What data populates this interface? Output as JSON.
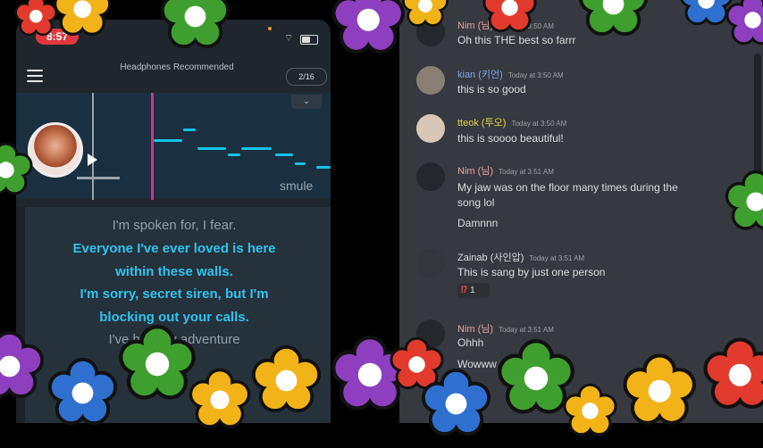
{
  "phone": {
    "time": "8:57",
    "header": "Headphones Recommended",
    "pager": "2/16",
    "logo": "smule",
    "lyrics": [
      {
        "text": "I'm spoken for, I fear.",
        "state": "dim"
      },
      {
        "text": "Everyone I've ever loved is here",
        "state": "active"
      },
      {
        "text": "within these walls.",
        "state": "active"
      },
      {
        "text": "I'm sorry, secret siren, but I'm",
        "state": "active"
      },
      {
        "text": "blocking out your calls.",
        "state": "active"
      },
      {
        "text": "I've had my adventure",
        "state": "dim"
      }
    ],
    "icons": {
      "menu": "hamburger-icon",
      "collapse": "chevron-down-icon",
      "play": "play-icon",
      "wifi": "wifi-icon",
      "battery": "battery-icon",
      "mic": "mic-icon"
    }
  },
  "chat": {
    "messages": [
      {
        "author": "Nim (님)",
        "color": "#e8a6a6",
        "time": "Today at 3:50 AM",
        "lines": [
          "Oh this THE best so farrr"
        ]
      },
      {
        "author": "kian (키언)",
        "color": "#7ea6f0",
        "time": "Today at 3:50 AM",
        "lines": [
          "this is so good"
        ]
      },
      {
        "author": "tteok (투오)",
        "color": "#e8d24a",
        "time": "Today at 3:50 AM",
        "lines": [
          "this is soooo beautiful!"
        ]
      },
      {
        "author": "Nim (님)",
        "color": "#e8a6a6",
        "time": "Today at 3:51 AM",
        "lines": [
          "My jaw was on the floor many times during the",
          "song lol",
          "Damnnn"
        ]
      },
      {
        "author": "Zainab (사인압)",
        "color": "#dcddde",
        "time": "Today at 3:51 AM",
        "lines": [
          "This is sang by just one person"
        ]
      },
      {
        "author": "Nim (님)",
        "color": "#e8a6a6",
        "time": "Today at 3:51 AM",
        "lines": [
          "Ohhh",
          "Wowww"
        ]
      }
    ],
    "reaction": {
      "emoji": "⁉",
      "count": "1"
    }
  },
  "decor": {
    "flower_colors": [
      "#e23a2c",
      "#f2b318",
      "#3f9f2e",
      "#2f6fcf",
      "#8d3fbf"
    ]
  }
}
